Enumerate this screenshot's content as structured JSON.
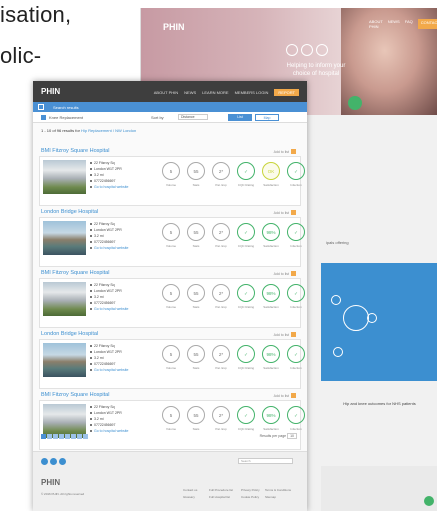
{
  "bg_text": [
    "isation,",
    "olic-"
  ],
  "bg_page": {
    "logo": "PHIN",
    "nav": [
      "ABOUT PHIN",
      "NEWS",
      "FAQ"
    ],
    "cta": "CONTACT",
    "tagline": "Helping to inform your choice of hospital",
    "side_text": "ipals offering",
    "bottom_text": "Hip and knee outcomes for NHS patients"
  },
  "front": {
    "logo": "PHIN",
    "nav": [
      "ABOUT PHIN",
      "NEWS",
      "LEARN MORE",
      "MEMBERS LOGIN"
    ],
    "cta": "REPORT",
    "search_label": "Search results",
    "filter_tag": "Knee Replacement",
    "sort_label": "Sort by",
    "sort_value": "Distance",
    "btn_list": "List",
    "btn_map": "Map",
    "results_prefix": "1 - 10 of 96 results for",
    "results_query": "Hip Replacement / NW London",
    "add_label": "Add to list",
    "metric_caps": [
      "Volume",
      "Stats",
      "Pat. Exp",
      "CQC Rating",
      "Satisfaction",
      "Infection"
    ],
    "cards": [
      {
        "title": "BMI Fitzroy Square Hospital",
        "img": "b1",
        "addr": "22 Fitzroy Sq",
        "city": "London W1T 2PR",
        "dist": "3.2 mi",
        "phone": "07722456697",
        "link": "Go to hospital website",
        "vals": [
          "5",
          "55",
          "2*",
          "✓",
          "OK",
          "✓"
        ]
      },
      {
        "title": "London Bridge Hospital",
        "img": "b2",
        "addr": "22 Fitzroy Sq",
        "city": "London W1T 2PR",
        "dist": "3.2 mi",
        "phone": "07722456697",
        "link": "Go to hospital website",
        "vals": [
          "5",
          "55",
          "2*",
          "✓",
          "98%",
          "✓"
        ]
      },
      {
        "title": "BMI Fitzroy Square Hospital",
        "img": "b1",
        "addr": "22 Fitzroy Sq",
        "city": "London W1T 2PR",
        "dist": "3.2 mi",
        "phone": "07722456697",
        "link": "Go to hospital website",
        "vals": [
          "5",
          "55",
          "2*",
          "✓",
          "98%",
          "✓"
        ]
      },
      {
        "title": "London Bridge Hospital",
        "img": "b2",
        "addr": "22 Fitzroy Sq",
        "city": "London W1T 2PR",
        "dist": "3.2 mi",
        "phone": "07722456697",
        "link": "Go to hospital website",
        "vals": [
          "5",
          "55",
          "2*",
          "✓",
          "98%",
          "✓"
        ]
      },
      {
        "title": "BMI Fitzroy Square Hospital",
        "img": "b1",
        "addr": "22 Fitzroy Sq",
        "city": "London W1T 2PR",
        "dist": "3.2 mi",
        "phone": "07722456697",
        "link": "Go to hospital website",
        "vals": [
          "5",
          "55",
          "2*",
          "✓",
          "98%",
          "✓"
        ]
      }
    ],
    "per_page": "Results per page",
    "per_page_value": "10",
    "footer": {
      "logo": "PHIN",
      "copyright": "© 2016 PHIN. All rights reserved",
      "search_placeholder": "Search",
      "links": [
        "Contact us",
        "Full Procedure list",
        "Privacy Policy",
        "Terms & Conditions",
        "Glossary",
        "Full Hospital list",
        "Cookie Policy",
        "Sitemap"
      ]
    }
  },
  "colors": {
    "accent": "#4a90d4",
    "green": "#43b36a",
    "orange": "#f2a94a"
  }
}
